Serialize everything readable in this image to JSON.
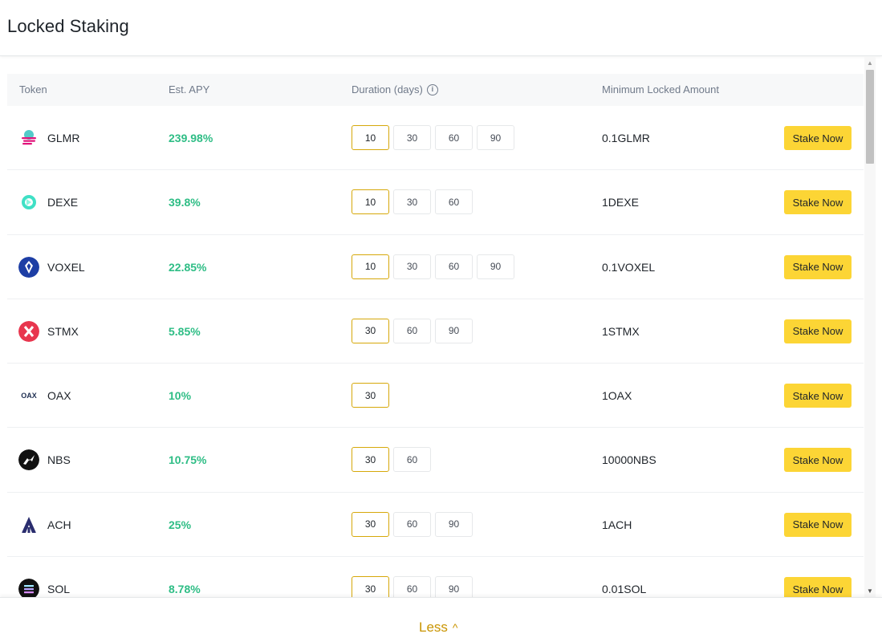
{
  "page": {
    "title": "Locked Staking"
  },
  "table": {
    "headers": {
      "token": "Token",
      "apy": "Est. APY",
      "duration": "Duration (days)",
      "min_amount": "Minimum Locked Amount"
    },
    "stake_label": "Stake Now",
    "rows": [
      {
        "token": "GLMR",
        "icon": "glmr-icon",
        "apy": "239.98%",
        "durations": [
          "10",
          "30",
          "60",
          "90"
        ],
        "selected": "10",
        "min_amount": "0.1GLMR"
      },
      {
        "token": "DEXE",
        "icon": "dexe-icon",
        "apy": "39.8%",
        "durations": [
          "10",
          "30",
          "60"
        ],
        "selected": "10",
        "min_amount": "1DEXE"
      },
      {
        "token": "VOXEL",
        "icon": "voxel-icon",
        "apy": "22.85%",
        "durations": [
          "10",
          "30",
          "60",
          "90"
        ],
        "selected": "10",
        "min_amount": "0.1VOXEL"
      },
      {
        "token": "STMX",
        "icon": "stmx-icon",
        "apy": "5.85%",
        "durations": [
          "30",
          "60",
          "90"
        ],
        "selected": "30",
        "min_amount": "1STMX"
      },
      {
        "token": "OAX",
        "icon": "oax-icon",
        "apy": "10%",
        "durations": [
          "30"
        ],
        "selected": "30",
        "min_amount": "1OAX"
      },
      {
        "token": "NBS",
        "icon": "nbs-icon",
        "apy": "10.75%",
        "durations": [
          "30",
          "60"
        ],
        "selected": "30",
        "min_amount": "10000NBS"
      },
      {
        "token": "ACH",
        "icon": "ach-icon",
        "apy": "25%",
        "durations": [
          "30",
          "60",
          "90"
        ],
        "selected": "30",
        "min_amount": "1ACH"
      },
      {
        "token": "SOL",
        "icon": "sol-icon",
        "apy": "8.78%",
        "durations": [
          "30",
          "60",
          "90"
        ],
        "selected": "30",
        "min_amount": "0.01SOL"
      }
    ]
  },
  "footer": {
    "toggle_label": "Less"
  },
  "colors": {
    "apy_green": "#2ebd85",
    "stake_yellow": "#fcd535",
    "selected_border": "#d6a80a",
    "less_gold": "#c99400"
  }
}
